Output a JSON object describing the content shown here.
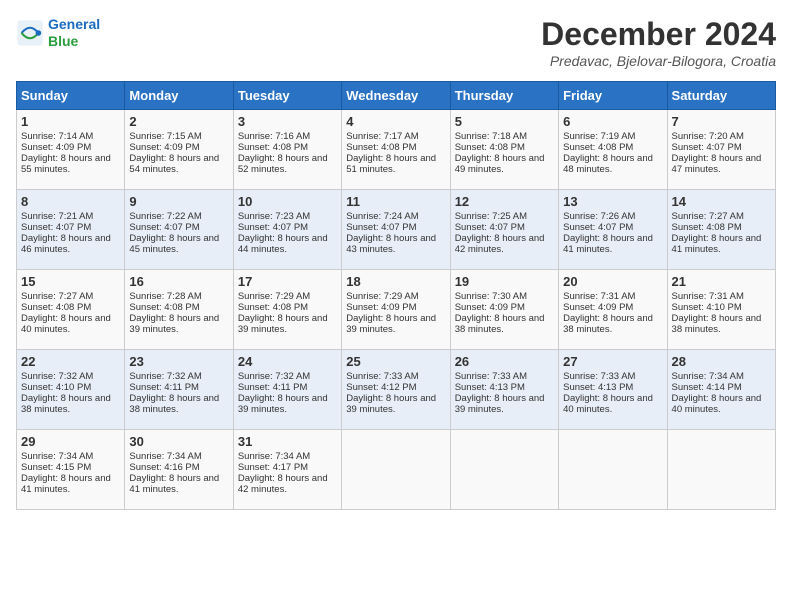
{
  "logo": {
    "line1": "General",
    "line2": "Blue"
  },
  "title": "December 2024",
  "location": "Predavac, Bjelovar-Bilogora, Croatia",
  "days_of_week": [
    "Sunday",
    "Monday",
    "Tuesday",
    "Wednesday",
    "Thursday",
    "Friday",
    "Saturday"
  ],
  "weeks": [
    [
      {
        "day": "1",
        "sunrise": "7:14 AM",
        "sunset": "4:09 PM",
        "daylight": "8 hours and 55 minutes."
      },
      {
        "day": "2",
        "sunrise": "7:15 AM",
        "sunset": "4:09 PM",
        "daylight": "8 hours and 54 minutes."
      },
      {
        "day": "3",
        "sunrise": "7:16 AM",
        "sunset": "4:08 PM",
        "daylight": "8 hours and 52 minutes."
      },
      {
        "day": "4",
        "sunrise": "7:17 AM",
        "sunset": "4:08 PM",
        "daylight": "8 hours and 51 minutes."
      },
      {
        "day": "5",
        "sunrise": "7:18 AM",
        "sunset": "4:08 PM",
        "daylight": "8 hours and 49 minutes."
      },
      {
        "day": "6",
        "sunrise": "7:19 AM",
        "sunset": "4:08 PM",
        "daylight": "8 hours and 48 minutes."
      },
      {
        "day": "7",
        "sunrise": "7:20 AM",
        "sunset": "4:07 PM",
        "daylight": "8 hours and 47 minutes."
      }
    ],
    [
      {
        "day": "8",
        "sunrise": "7:21 AM",
        "sunset": "4:07 PM",
        "daylight": "8 hours and 46 minutes."
      },
      {
        "day": "9",
        "sunrise": "7:22 AM",
        "sunset": "4:07 PM",
        "daylight": "8 hours and 45 minutes."
      },
      {
        "day": "10",
        "sunrise": "7:23 AM",
        "sunset": "4:07 PM",
        "daylight": "8 hours and 44 minutes."
      },
      {
        "day": "11",
        "sunrise": "7:24 AM",
        "sunset": "4:07 PM",
        "daylight": "8 hours and 43 minutes."
      },
      {
        "day": "12",
        "sunrise": "7:25 AM",
        "sunset": "4:07 PM",
        "daylight": "8 hours and 42 minutes."
      },
      {
        "day": "13",
        "sunrise": "7:26 AM",
        "sunset": "4:07 PM",
        "daylight": "8 hours and 41 minutes."
      },
      {
        "day": "14",
        "sunrise": "7:27 AM",
        "sunset": "4:08 PM",
        "daylight": "8 hours and 41 minutes."
      }
    ],
    [
      {
        "day": "15",
        "sunrise": "7:27 AM",
        "sunset": "4:08 PM",
        "daylight": "8 hours and 40 minutes."
      },
      {
        "day": "16",
        "sunrise": "7:28 AM",
        "sunset": "4:08 PM",
        "daylight": "8 hours and 39 minutes."
      },
      {
        "day": "17",
        "sunrise": "7:29 AM",
        "sunset": "4:08 PM",
        "daylight": "8 hours and 39 minutes."
      },
      {
        "day": "18",
        "sunrise": "7:29 AM",
        "sunset": "4:09 PM",
        "daylight": "8 hours and 39 minutes."
      },
      {
        "day": "19",
        "sunrise": "7:30 AM",
        "sunset": "4:09 PM",
        "daylight": "8 hours and 38 minutes."
      },
      {
        "day": "20",
        "sunrise": "7:31 AM",
        "sunset": "4:09 PM",
        "daylight": "8 hours and 38 minutes."
      },
      {
        "day": "21",
        "sunrise": "7:31 AM",
        "sunset": "4:10 PM",
        "daylight": "8 hours and 38 minutes."
      }
    ],
    [
      {
        "day": "22",
        "sunrise": "7:32 AM",
        "sunset": "4:10 PM",
        "daylight": "8 hours and 38 minutes."
      },
      {
        "day": "23",
        "sunrise": "7:32 AM",
        "sunset": "4:11 PM",
        "daylight": "8 hours and 38 minutes."
      },
      {
        "day": "24",
        "sunrise": "7:32 AM",
        "sunset": "4:11 PM",
        "daylight": "8 hours and 39 minutes."
      },
      {
        "day": "25",
        "sunrise": "7:33 AM",
        "sunset": "4:12 PM",
        "daylight": "8 hours and 39 minutes."
      },
      {
        "day": "26",
        "sunrise": "7:33 AM",
        "sunset": "4:13 PM",
        "daylight": "8 hours and 39 minutes."
      },
      {
        "day": "27",
        "sunrise": "7:33 AM",
        "sunset": "4:13 PM",
        "daylight": "8 hours and 40 minutes."
      },
      {
        "day": "28",
        "sunrise": "7:34 AM",
        "sunset": "4:14 PM",
        "daylight": "8 hours and 40 minutes."
      }
    ],
    [
      {
        "day": "29",
        "sunrise": "7:34 AM",
        "sunset": "4:15 PM",
        "daylight": "8 hours and 41 minutes."
      },
      {
        "day": "30",
        "sunrise": "7:34 AM",
        "sunset": "4:16 PM",
        "daylight": "8 hours and 41 minutes."
      },
      {
        "day": "31",
        "sunrise": "7:34 AM",
        "sunset": "4:17 PM",
        "daylight": "8 hours and 42 minutes."
      },
      null,
      null,
      null,
      null
    ]
  ],
  "labels": {
    "sunrise": "Sunrise:",
    "sunset": "Sunset:",
    "daylight": "Daylight:"
  }
}
